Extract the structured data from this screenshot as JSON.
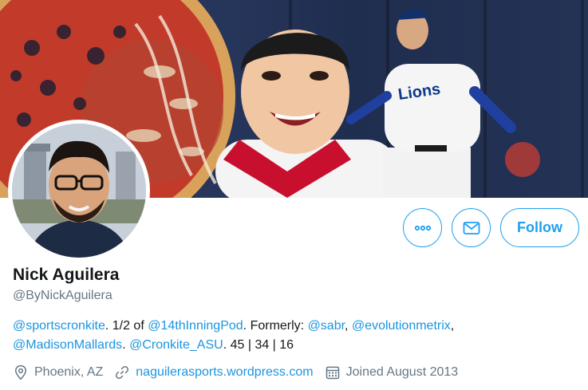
{
  "profile": {
    "display_name": "Nick Aguilera",
    "handle": "@ByNickAguilera"
  },
  "actions": {
    "follow_label": "Follow"
  },
  "bio": {
    "parts": {
      "m1": "@sportscronkite",
      "t1": ". 1/2 of ",
      "m2": "@14thInningPod",
      "t2": ". Formerly: ",
      "m3": "@sabr",
      "t3": ", ",
      "m4": "@evolutionmetrix",
      "t4": ",",
      "m5": "@MadisonMallards",
      "t5": ". ",
      "m6": "@Cronkite_ASU",
      "t6": ". 45 | 34 | 16"
    }
  },
  "meta": {
    "location": "Phoenix, AZ",
    "website": "naguilerasports.wordpress.com",
    "joined": "Joined August 2013"
  },
  "icons": {
    "more": "more-icon",
    "mail": "mail-icon",
    "location": "location-pin-icon",
    "link": "link-icon",
    "calendar": "calendar-icon"
  },
  "colors": {
    "accent": "#1da1f2",
    "link": "#1b95e0",
    "secondary_text": "#657786"
  }
}
